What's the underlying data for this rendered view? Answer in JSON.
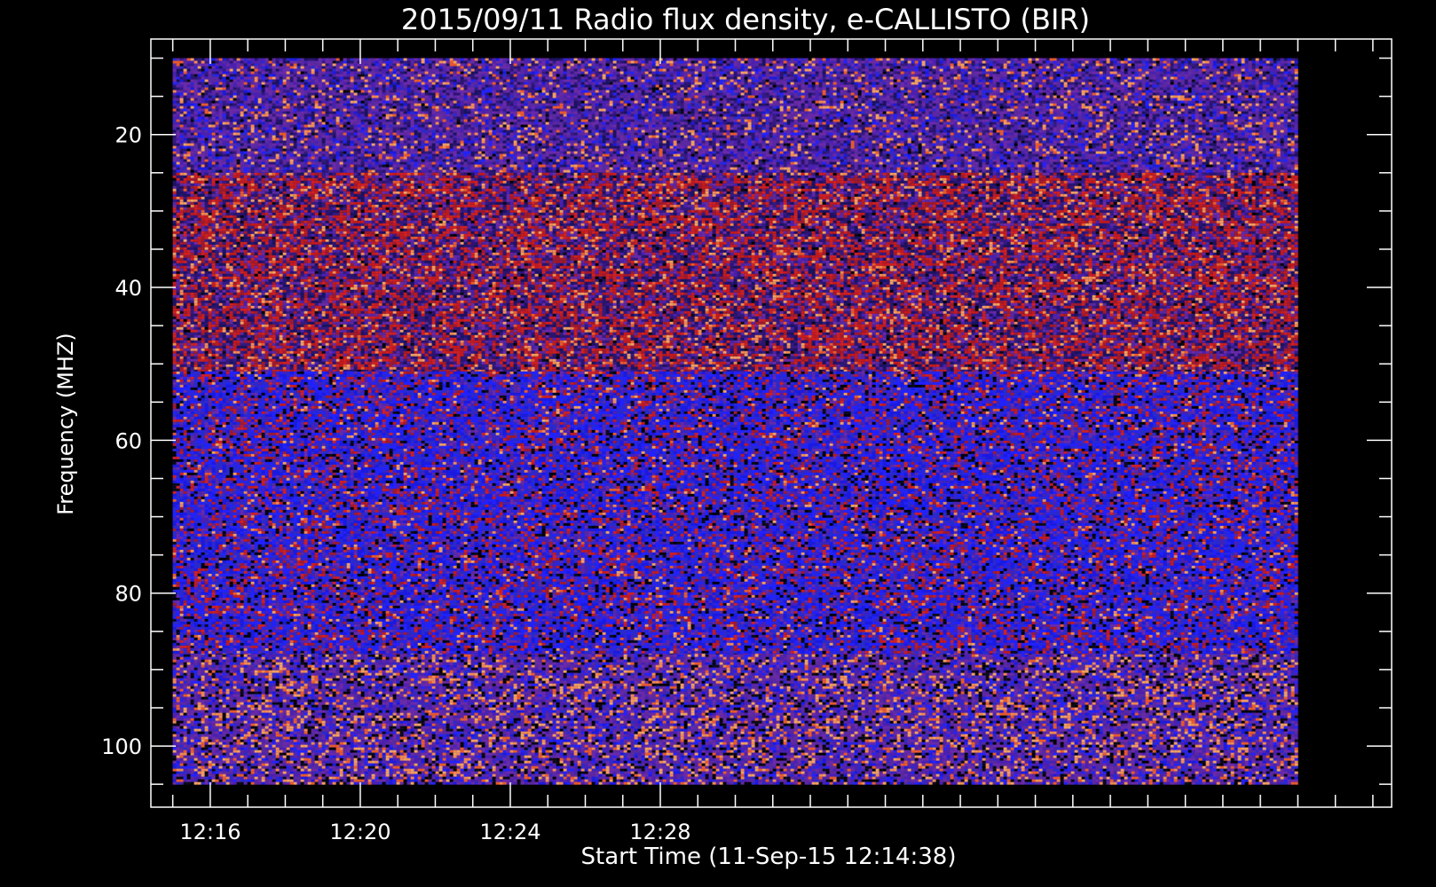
{
  "chart_data": {
    "type": "heatmap",
    "title": "2015/09/11  Radio flux density, e-CALLISTO (BIR)",
    "xlabel": "Start Time (11-Sep-15 12:14:38)",
    "ylabel": "Frequency (MHZ)",
    "x_axis": {
      "unit": "time of day (UT)",
      "range": [
        "12:14:25",
        "12:47:30"
      ],
      "data_extent": [
        "12:15:00",
        "12:45:00"
      ],
      "major_ticks": [
        "12:16",
        "12:20",
        "12:24",
        "12:28"
      ],
      "minor_tick_interval": "1 minute"
    },
    "y_axis": {
      "unit": "MHz",
      "range": [
        108,
        7.5
      ],
      "inverted": true,
      "data_extent": [
        10,
        105
      ],
      "major_ticks": [
        20,
        40,
        60,
        80,
        100
      ],
      "minor_tick_interval": 5
    },
    "bands": [
      {
        "freq_range": [
          10,
          25
        ],
        "dominant_color": "purple",
        "mix": {
          "purple": 0.45,
          "navy": 0.25,
          "blue": 0.15,
          "orange": 0.12,
          "black": 0.03
        }
      },
      {
        "freq_range": [
          25,
          51
        ],
        "dominant_color": "dark red",
        "mix": {
          "red": 0.35,
          "navy": 0.3,
          "purple": 0.2,
          "orange": 0.12,
          "black": 0.03
        }
      },
      {
        "freq_range": [
          51,
          88
        ],
        "dominant_color": "blue",
        "mix": {
          "blue": 0.5,
          "purple": 0.2,
          "red": 0.15,
          "black": 0.1,
          "orange": 0.05
        }
      },
      {
        "freq_range": [
          88,
          105
        ],
        "dominant_color": "purple",
        "mix": {
          "purple": 0.45,
          "blue": 0.2,
          "orange": 0.2,
          "black": 0.15
        }
      }
    ],
    "colormap": [
      "#000000",
      "#1a1acc",
      "#3a22a8",
      "#5a28a0",
      "#8a1a5a",
      "#c41a1a",
      "#e85a2a",
      "#f0a060"
    ],
    "grid": false,
    "legend": "none"
  },
  "style": {
    "background": "#000000",
    "foreground": "#ffffff"
  }
}
